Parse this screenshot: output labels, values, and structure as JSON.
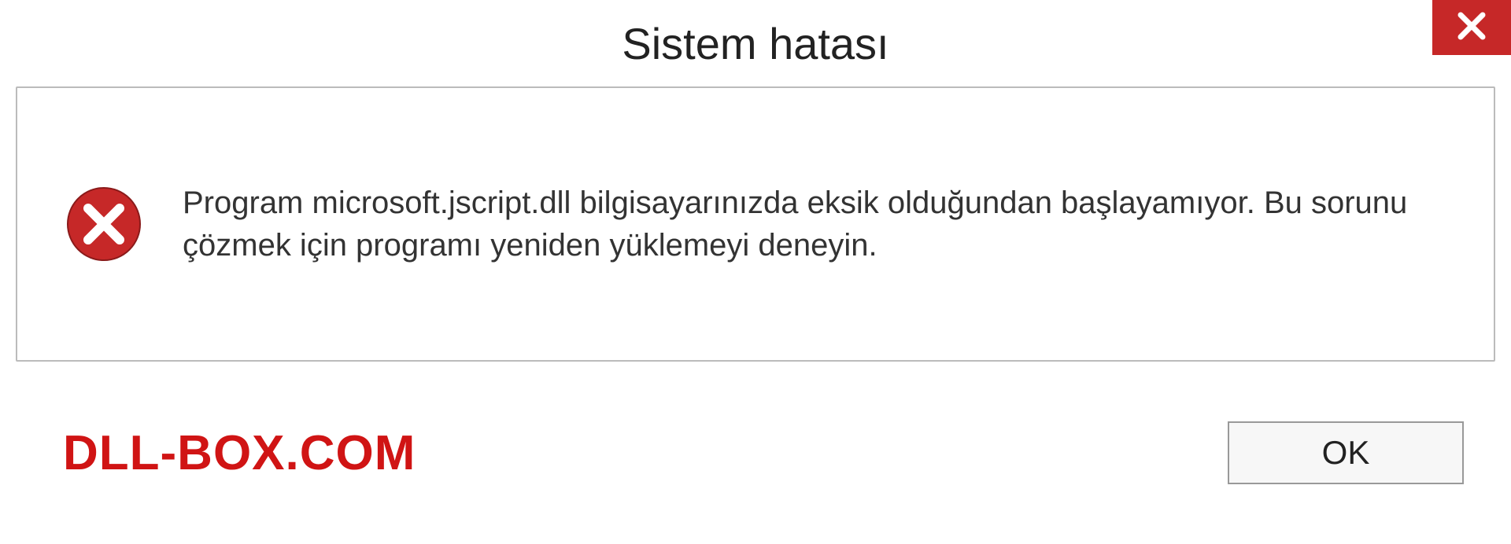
{
  "dialog": {
    "title": "Sistem hatası",
    "message": "Program microsoft.jscript.dll bilgisayarınızda eksik olduğundan başlayamıyor. Bu sorunu çözmek için programı yeniden yüklemeyi deneyin.",
    "ok_label": "OK"
  },
  "watermark": "DLL-BOX.COM",
  "colors": {
    "close_bg": "#c62828",
    "watermark": "#d01414",
    "error_icon": "#c62828"
  }
}
